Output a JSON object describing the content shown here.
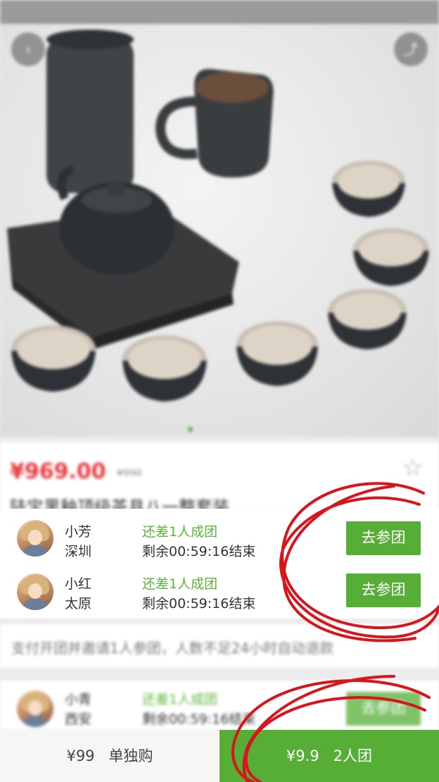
{
  "background": {
    "product": {
      "price": "¥969.00",
      "original_price": "¥990",
      "title": "陆宝黑釉顶级茶具八一整套装"
    },
    "notice": "支付开团并邀请1人参团，人数不足24小时自动退款",
    "partial_group": {
      "name": "小青",
      "city": "西安",
      "need": "还差1人成团",
      "remain": "剩余00:59:16结束",
      "button": "去参团"
    }
  },
  "popup": {
    "groups": [
      {
        "name": "小芳",
        "city": "深圳",
        "need": "还差1人成团",
        "remain": "剩余00:59:16结束",
        "button": "去参团"
      },
      {
        "name": "小红",
        "city": "太原",
        "need": "还差1人成团",
        "remain": "剩余00:59:16结束",
        "button": "去参团"
      }
    ]
  },
  "bottom_bar": {
    "single_price": "¥99",
    "single_label": "单独购",
    "group_price": "¥9.9",
    "group_label": "2人团"
  },
  "colors": {
    "accent_green": "#56ae36",
    "need_text_green": "#5cb53a",
    "price_red": "#e4393c",
    "annotation_red": "#d8141c"
  },
  "icons": {
    "back": "back-icon",
    "share": "share-icon",
    "favorite": "star-icon"
  }
}
